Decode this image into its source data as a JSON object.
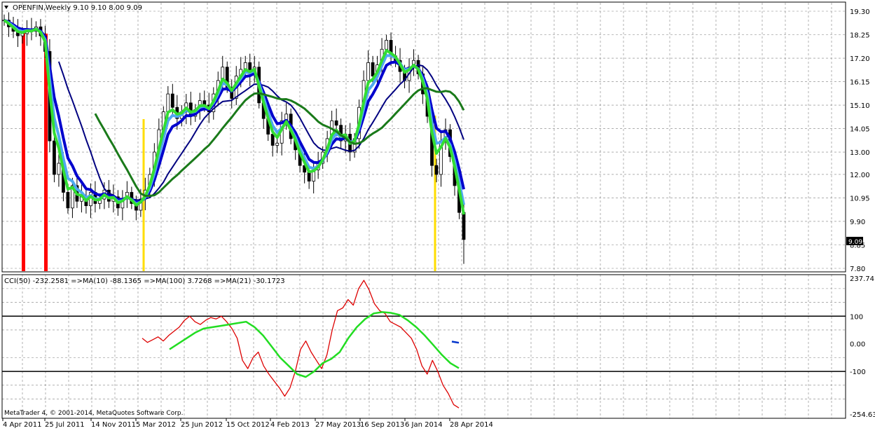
{
  "symbol_header": "OPENFIN,Weekly  9.10 9.10 8.00 9.09",
  "price_badge": "9.09",
  "copyright": "MetaTrader 4, © 2001-2014, MetaQuotes Software Corp.",
  "indicator_header": "CCI(50) -232.2581  =>MA(10) -88.1365  =>MA(100) 3.7268  =>MA(21) -30.1723",
  "colors": {
    "background": "#ffffff",
    "grid": "#808080",
    "candle": "#000000",
    "ma_navy": "#000080",
    "ma_blue": "#0000cd",
    "ma_lightblue": "#4fa8f0",
    "ma_lime": "#33dd33",
    "ma_darkgreen": "#1a7a1a",
    "signal_red": "#ff0000",
    "signal_yellow": "#ffdd00",
    "cci_line": "#dd0000",
    "cci_ma": "#22dd22",
    "cci_short": "#0033cc"
  },
  "chart_data": [
    {
      "type": "line",
      "title": "OPENFIN,Weekly",
      "ylim": [
        7.8,
        19.3
      ],
      "y_ticks": [
        "19.30",
        "18.25",
        "17.20",
        "16.15",
        "15.10",
        "14.05",
        "13.00",
        "12.00",
        "10.95",
        "9.90",
        "8.85",
        "7.80"
      ],
      "y_tick_values": [
        19.3,
        18.25,
        17.2,
        16.15,
        15.1,
        14.05,
        13.0,
        12.0,
        10.95,
        9.9,
        8.85,
        7.8
      ],
      "x_ticks": [
        "4 Apr 2011",
        "25 Jul 2011",
        "14 Nov 2011",
        "5 Mar 2012",
        "25 Jun 2012",
        "15 Oct 2012",
        "4 Feb 2013",
        "27 May 2013",
        "16 Sep 2013",
        "6 Jan 2014",
        "28 Apr 2014"
      ],
      "last_price": 9.09,
      "ohlc_last": {
        "open": 9.1,
        "high": 9.1,
        "low": 8.0,
        "close": 9.09
      },
      "close": [
        18.9,
        18.6,
        18.4,
        18.2,
        18.3,
        18.5,
        18.4,
        18.6,
        18.2,
        17.5,
        13.5,
        12.0,
        12.5,
        11.2,
        10.5,
        11.5,
        10.8,
        11.0,
        10.6,
        11.2,
        10.7,
        10.9,
        11.3,
        10.8,
        11.0,
        10.5,
        10.9,
        11.2,
        10.7,
        10.4,
        10.9,
        11.3,
        12.0,
        13.0,
        14.0,
        14.8,
        15.6,
        15.0,
        14.5,
        14.8,
        15.2,
        14.6,
        14.9,
        15.3,
        15.1,
        14.8,
        15.6,
        16.2,
        16.8,
        15.9,
        15.4,
        16.4,
        16.7,
        17.0,
        16.5,
        16.8,
        15.2,
        14.5,
        13.8,
        13.3,
        13.4,
        14.4,
        14.7,
        13.6,
        13.1,
        12.4,
        12.1,
        11.7,
        12.2,
        12.5,
        13.0,
        13.6,
        14.4,
        14.2,
        13.5,
        13.8,
        13.0,
        13.6,
        15.0,
        16.2,
        17.0,
        16.4,
        16.9,
        17.6,
        18.0,
        17.3,
        17.1,
        16.6,
        16.2,
        16.8,
        17.1,
        16.5,
        15.6,
        14.6,
        12.4,
        12.0,
        13.5,
        14.0,
        12.8,
        11.5,
        10.3,
        9.09
      ]
    },
    {
      "type": "line",
      "title": "CCI(50)",
      "ylim": [
        -254.639,
        237.7417
      ],
      "y_ticks": [
        "237.7417",
        "100",
        "0.00",
        "-100",
        "-254.639"
      ],
      "y_tick_values": [
        237.7417,
        100,
        0,
        -100,
        -254.639
      ],
      "levels": [
        100,
        -100
      ],
      "series": [
        {
          "name": "CCI(50)",
          "values": [
            20,
            5,
            15,
            25,
            10,
            30,
            45,
            60,
            85,
            100,
            80,
            70,
            85,
            95,
            90,
            100,
            80,
            55,
            20,
            -60,
            -90,
            -50,
            -30,
            -80,
            -110,
            -135,
            -160,
            -190,
            -160,
            -100,
            -20,
            10,
            -30,
            -60,
            -90,
            -40,
            50,
            120,
            130,
            160,
            140,
            200,
            230,
            195,
            145,
            120,
            110,
            80,
            70,
            60,
            40,
            20,
            -20,
            -80,
            -110,
            -60,
            -100,
            -150,
            -180,
            -220,
            -232.2581
          ],
          "last": -232.2581
        },
        {
          "name": "MA(21)",
          "values": [
            -20,
            0,
            20,
            40,
            55,
            60,
            65,
            70,
            75,
            80,
            60,
            30,
            -10,
            -50,
            -80,
            -110,
            -120,
            -100,
            -70,
            -55,
            -30,
            20,
            60,
            90,
            110,
            115,
            112,
            105,
            85,
            60,
            30,
            -5,
            -40,
            -70,
            -88.1365
          ],
          "last": -88.1365
        },
        {
          "name": "MA(100)",
          "values": [
            8,
            3.7268
          ],
          "last": 3.7268
        }
      ]
    }
  ]
}
